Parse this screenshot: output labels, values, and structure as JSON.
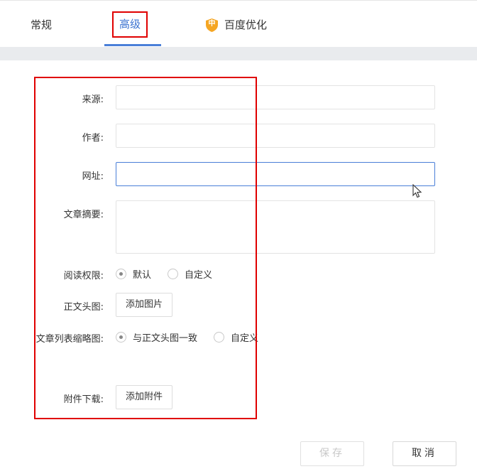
{
  "tabs": {
    "general": "常规",
    "advanced": "高级",
    "baidu_badge": "中",
    "baidu": "百度优化"
  },
  "form": {
    "source_label": "来源:",
    "source_value": "",
    "author_label": "作者:",
    "author_value": "",
    "url_label": "网址:",
    "url_value": "",
    "summary_label": "文章摘要:",
    "summary_value": "",
    "read_permission_label": "阅读权限:",
    "read_permission_options": [
      "默认",
      "自定义"
    ],
    "read_permission_selected": "默认",
    "header_image_label": "正文头图:",
    "add_image_button": "添加图片",
    "thumbnail_label": "文章列表缩略图:",
    "thumbnail_options": [
      "与正文头图一致",
      "自定义"
    ],
    "thumbnail_selected": "与正文头图一致",
    "attachment_label": "附件下载:",
    "add_attachment_button": "添加附件"
  },
  "footer": {
    "save": "保存",
    "cancel": "取消"
  },
  "colors": {
    "accent": "#4a7fd8",
    "highlight_box": "#e00000",
    "shield": "#f5a623"
  }
}
